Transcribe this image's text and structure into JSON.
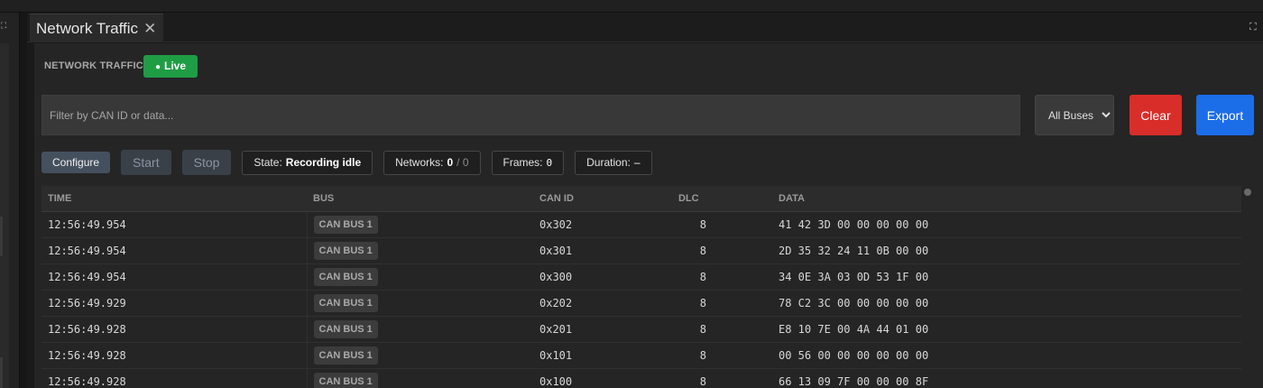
{
  "tab": {
    "title": "Network Traffic",
    "close_glyph": "✕"
  },
  "expand_glyph": "⛶",
  "header": {
    "section_title": "NETWORK TRAFFIC",
    "live_dot": "●",
    "live_label": "Live"
  },
  "filter": {
    "placeholder": "Filter by CAN ID or data...",
    "value": ""
  },
  "bus_select": {
    "options": [
      "All Buses"
    ],
    "selected": "All Buses"
  },
  "buttons": {
    "clear": "Clear",
    "export": "Export",
    "configure": "Configure",
    "start": "Start",
    "stop": "Stop"
  },
  "stats": {
    "state_label": "State:",
    "state_value": "Recording idle",
    "networks_label": "Networks:",
    "networks_value": "0",
    "networks_total": "/ 0",
    "frames_label": "Frames:",
    "frames_value": "0",
    "duration_label": "Duration:",
    "duration_value": "–"
  },
  "table": {
    "columns": [
      "TIME",
      "BUS",
      "CAN ID",
      "DLC",
      "DATA"
    ],
    "rows": [
      {
        "time": "12:56:49.954",
        "bus": "CAN BUS 1",
        "can_id": "0x302",
        "dlc": "8",
        "data": "41 42 3D 00 00 00 00 00"
      },
      {
        "time": "12:56:49.954",
        "bus": "CAN BUS 1",
        "can_id": "0x301",
        "dlc": "8",
        "data": "2D 35 32 24 11 0B 00 00"
      },
      {
        "time": "12:56:49.954",
        "bus": "CAN BUS 1",
        "can_id": "0x300",
        "dlc": "8",
        "data": "34 0E 3A 03 0D 53 1F 00"
      },
      {
        "time": "12:56:49.929",
        "bus": "CAN BUS 1",
        "can_id": "0x202",
        "dlc": "8",
        "data": "78 C2 3C 00 00 00 00 00"
      },
      {
        "time": "12:56:49.928",
        "bus": "CAN BUS 1",
        "can_id": "0x201",
        "dlc": "8",
        "data": "E8 10 7E 00 4A 44 01 00"
      },
      {
        "time": "12:56:49.928",
        "bus": "CAN BUS 1",
        "can_id": "0x101",
        "dlc": "8",
        "data": "00 56 00 00 00 00 00 00"
      },
      {
        "time": "12:56:49.928",
        "bus": "CAN BUS 1",
        "can_id": "0x100",
        "dlc": "8",
        "data": "66 13 09 7F 00 00 00 8F"
      }
    ]
  }
}
